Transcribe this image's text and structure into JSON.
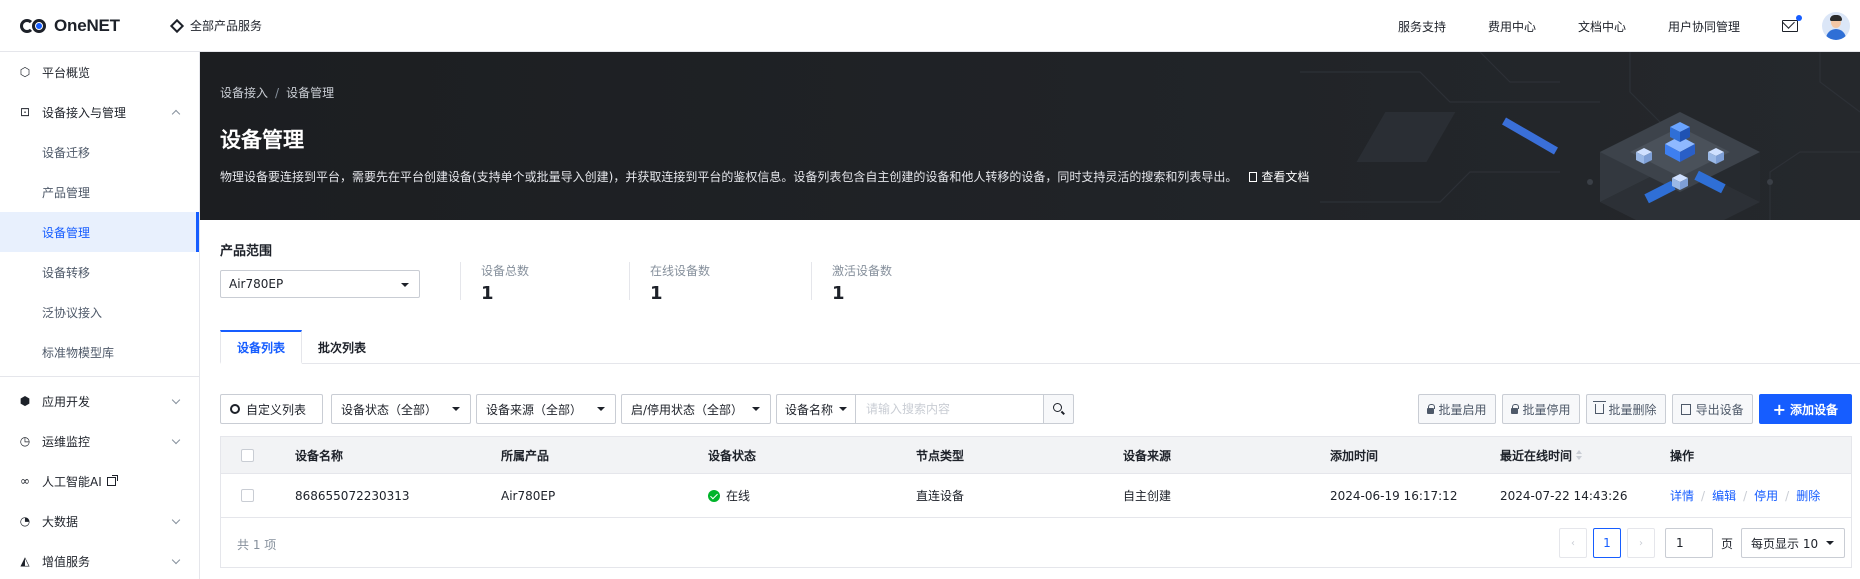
{
  "topbar": {
    "logo_text": "OneNET",
    "all_products": "全部产品服务",
    "nav": [
      "服务支持",
      "费用中心",
      "文档中心",
      "用户协同管理"
    ]
  },
  "sidebar": {
    "items": [
      {
        "label": "平台概览",
        "icon": "overview-icon"
      },
      {
        "label": "设备接入与管理",
        "icon": "device-access-icon",
        "expanded": true
      },
      {
        "label": "设备迁移"
      },
      {
        "label": "产品管理"
      },
      {
        "label": "设备管理",
        "active": true
      },
      {
        "label": "设备转移"
      },
      {
        "label": "泛协议接入"
      },
      {
        "label": "标准物模型库"
      },
      {
        "label": "应用开发",
        "icon": "app-dev-icon"
      },
      {
        "label": "运维监控",
        "icon": "monitor-icon"
      },
      {
        "label": "人工智能AI",
        "icon": "ai-icon"
      },
      {
        "label": "大数据",
        "icon": "bigdata-icon"
      },
      {
        "label": "增值服务",
        "icon": "value-added-icon"
      }
    ]
  },
  "hero": {
    "breadcrumb": [
      "设备接入",
      "设备管理"
    ],
    "title": "设备管理",
    "description": "物理设备要连接到平台，需要先在平台创建设备(支持单个或批量导入创建)，并获取连接到平台的鉴权信息。设备列表包含自主创建的设备和他人转移的设备，同时支持灵活的搜索和列表导出。",
    "doc_link": "查看文档"
  },
  "stats": {
    "product_scope_label": "产品范围",
    "product_selected": "Air780EP",
    "total_label": "设备总数",
    "total_value": "1",
    "online_label": "在线设备数",
    "online_value": "1",
    "active_label": "激活设备数",
    "active_value": "1"
  },
  "tabs": [
    "设备列表",
    "批次列表"
  ],
  "toolbar": {
    "custom_columns": "自定义列表",
    "status_filter": "设备状态（全部）",
    "source_filter": "设备来源（全部）",
    "enable_filter": "启/停用状态（全部）",
    "search_type": "设备名称",
    "search_placeholder": "请输入搜索内容",
    "batch_enable": "批量启用",
    "batch_disable": "批量停用",
    "batch_delete": "批量删除",
    "export": "导出设备",
    "add": "添加设备"
  },
  "table": {
    "columns": [
      "设备名称",
      "所属产品",
      "设备状态",
      "节点类型",
      "设备来源",
      "添加时间",
      "最近在线时间",
      "操作"
    ],
    "rows": [
      {
        "name": "868655072230313",
        "product": "Air780EP",
        "status": "在线",
        "node_type": "直连设备",
        "source": "自主创建",
        "added": "2024-06-19 16:17:12",
        "last_online": "2024-07-22 14:43:26",
        "ops": [
          "详情",
          "编辑",
          "停用",
          "删除"
        ]
      }
    ],
    "total": "共 1 项"
  },
  "pagination": {
    "current": "1",
    "jump_value": "1",
    "page_unit": "页",
    "page_size": "每页显示 10"
  },
  "colors": {
    "accent": "#165dff",
    "hero_bg": "#1c1e21",
    "online": "#00b42a"
  }
}
